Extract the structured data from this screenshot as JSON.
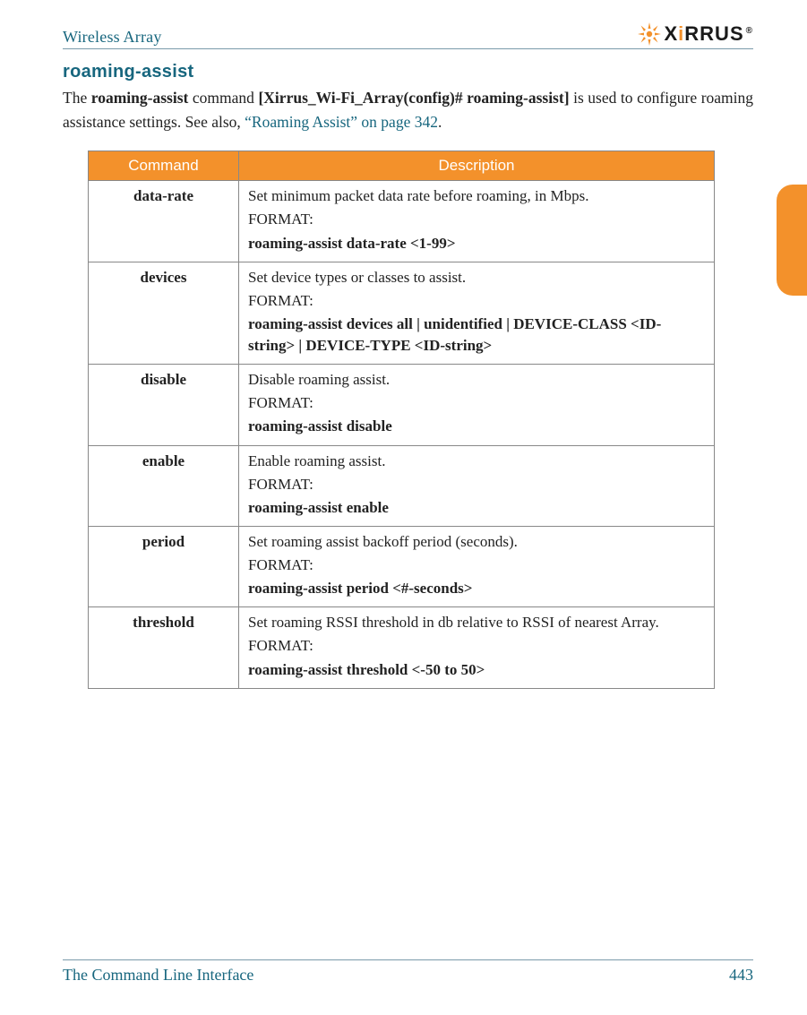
{
  "header": {
    "title": "Wireless Array",
    "logo_text": "XIRRUS",
    "logo_i": "i",
    "logo_reg": "®"
  },
  "section": {
    "title": "roaming-assist",
    "intro_1": "The ",
    "intro_cmd": "roaming-assist",
    "intro_2": " command ",
    "intro_prompt": "[Xirrus_Wi-Fi_Array(config)# roaming-assist]",
    "intro_3": " is used to configure roaming assistance settings. See also, ",
    "intro_link": "“Roaming Assist” on page 342",
    "intro_4": "."
  },
  "table": {
    "col1": "Command",
    "col2": "Description",
    "rows": [
      {
        "cmd": "data-rate",
        "desc": " Set minimum packet data rate before roaming, in Mbps.",
        "format_label": "FORMAT:",
        "syntax": "roaming-assist data-rate <1-99>"
      },
      {
        "cmd": "devices",
        "desc": " Set device types or classes to assist.",
        "format_label": "FORMAT:",
        "syntax": "roaming-assist devices all | unidentified | DEVICE-CLASS <ID-string> | DEVICE-TYPE <ID-string>"
      },
      {
        "cmd": "disable",
        "desc": "Disable roaming assist.",
        "format_label": "FORMAT:",
        "syntax": "roaming-assist disable"
      },
      {
        "cmd": "enable",
        "desc": "Enable roaming assist.",
        "format_label": "FORMAT:",
        "syntax": "roaming-assist enable"
      },
      {
        "cmd": "period",
        "desc": " Set roaming assist backoff period (seconds).",
        "format_label": "FORMAT:",
        "syntax": "roaming-assist period <#-seconds>"
      },
      {
        "cmd": "threshold",
        "desc": " Set roaming RSSI threshold in db relative to RSSI of nearest Array.",
        "format_label": "FORMAT:",
        "syntax": "roaming-assist threshold <-50 to 50>"
      }
    ]
  },
  "footer": {
    "left": "The Command Line Interface",
    "right": "443"
  }
}
